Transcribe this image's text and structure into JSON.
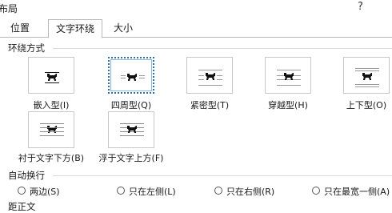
{
  "dialog": {
    "title": "布局",
    "help_glyph": "?"
  },
  "tabs": [
    {
      "label": "位置",
      "selected": false
    },
    {
      "label": "文字环绕",
      "selected": true
    },
    {
      "label": "大小",
      "selected": false
    }
  ],
  "wrap_style": {
    "group_label": "环绕方式",
    "options": [
      {
        "label": "嵌入型(I)",
        "icon": "inline-with-text-icon",
        "selected": false
      },
      {
        "label": "四周型(Q)",
        "icon": "square-wrap-icon",
        "selected": true
      },
      {
        "label": "紧密型(T)",
        "icon": "tight-wrap-icon",
        "selected": false
      },
      {
        "label": "穿越型(H)",
        "icon": "through-wrap-icon",
        "selected": false
      },
      {
        "label": "上下型(O)",
        "icon": "top-bottom-wrap-icon",
        "selected": false
      },
      {
        "label": "衬于文字下方(B)",
        "icon": "behind-text-icon",
        "selected": false
      },
      {
        "label": "浮于文字上方(F)",
        "icon": "in-front-of-text-icon",
        "selected": false
      }
    ]
  },
  "wrap_text": {
    "group_label": "自动换行",
    "options": [
      {
        "label": "两边(S)",
        "checked": false
      },
      {
        "label": "只在左侧(L)",
        "checked": false
      },
      {
        "label": "只在右侧(R)",
        "checked": false
      },
      {
        "label": "只在最宽一侧(A)",
        "checked": false
      }
    ]
  },
  "distance": {
    "group_label": "距正文"
  },
  "colors": {
    "accent": "#2a6fb0",
    "border": "#b9b9b9",
    "icon": "#111111"
  }
}
